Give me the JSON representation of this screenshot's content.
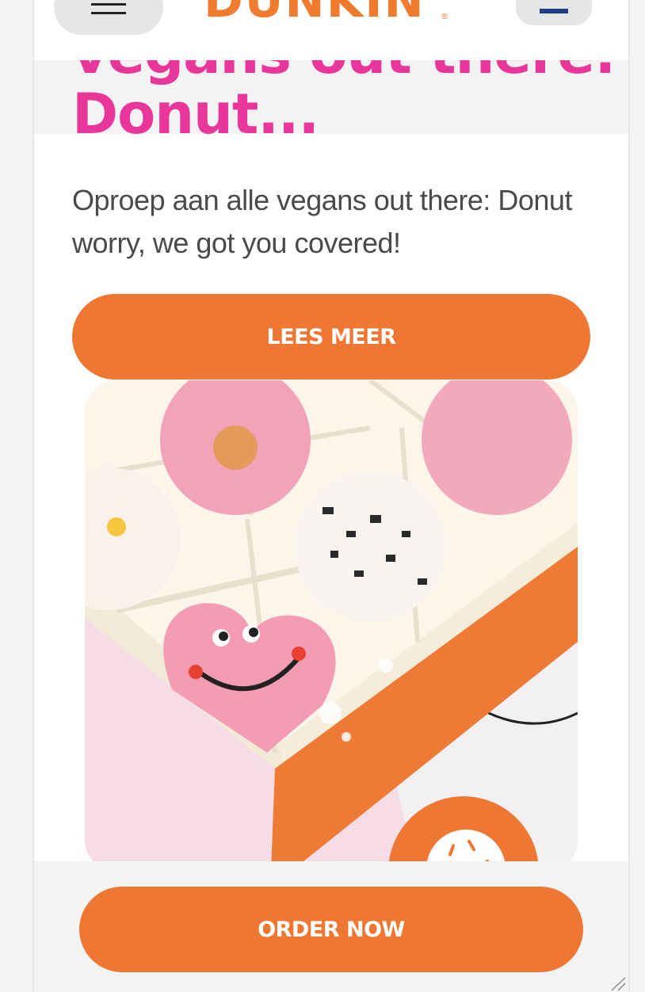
{
  "header": {
    "menu_icon": "hamburger-menu-icon",
    "logo_text": "DUNKIN",
    "logo_mark": "®",
    "account_icon": "account-icon"
  },
  "article": {
    "headline_line1": "vegans out there:",
    "headline_line2": "Donut...",
    "intro": "Oproep aan alle vegans out there: Donut worry, we got you covered!",
    "read_more_label": "LEES MEER"
  },
  "footer": {
    "order_label": "ORDER NOW"
  },
  "colors": {
    "brand_orange": "#ee7733",
    "brand_pink": "#e8369a",
    "navy": "#1f3f8c"
  }
}
